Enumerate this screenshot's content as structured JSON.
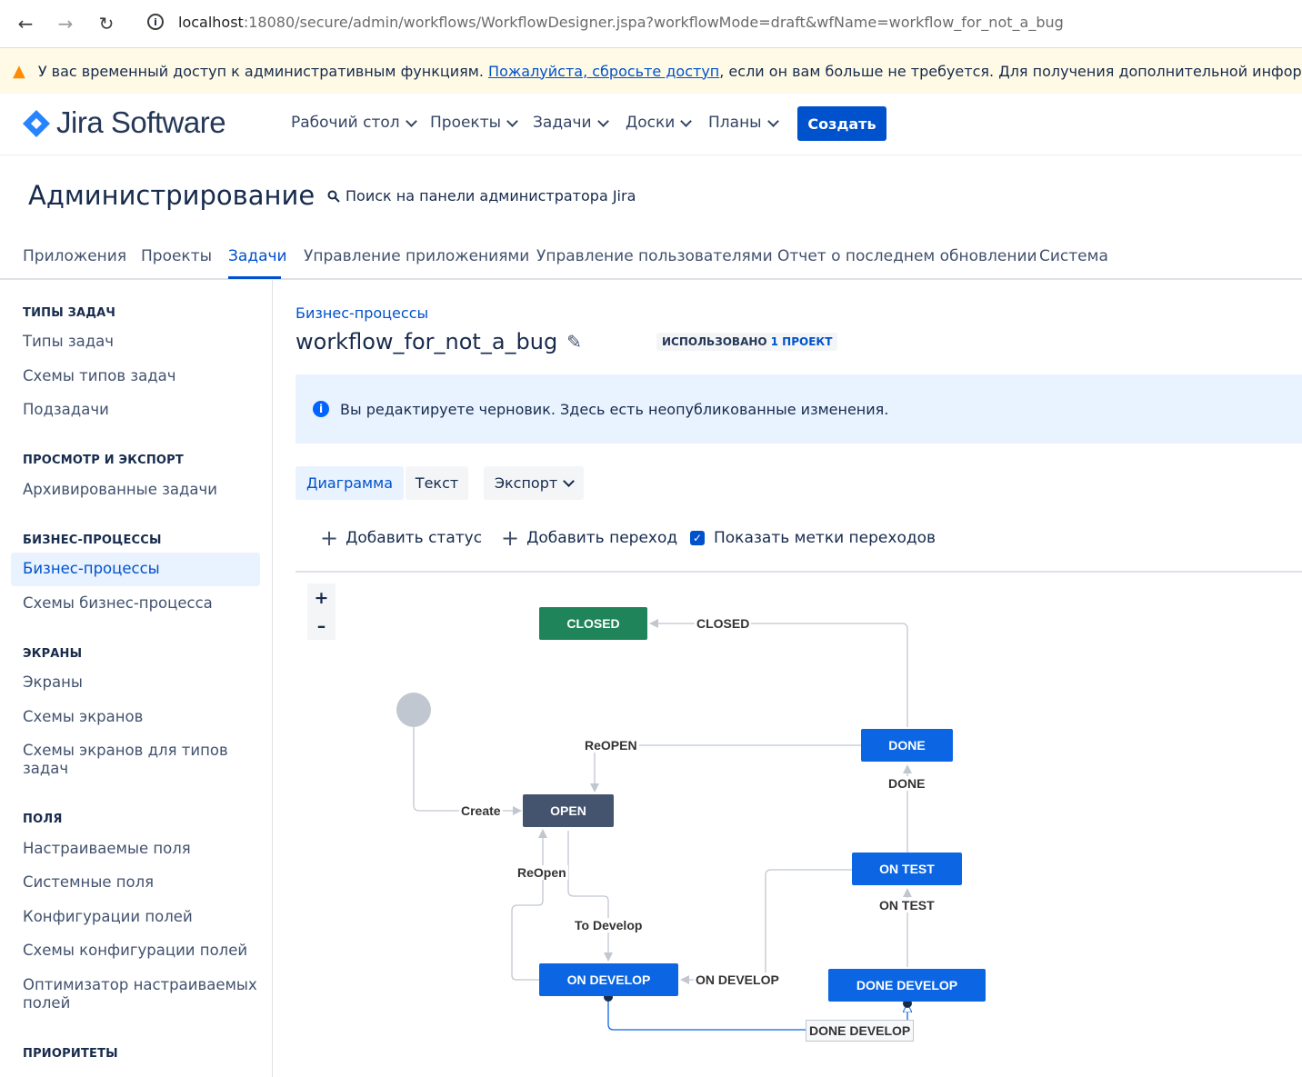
{
  "browser": {
    "url_host": "localhost",
    "url_rest": ":18080/secure/admin/workflows/WorkflowDesigner.jspa?workflowMode=draft&wfName=workflow_for_not_a_bug"
  },
  "warning": {
    "text_before": "У вас временный доступ к административным функциям.",
    "link": "Пожалуйста, сбросьте доступ",
    "text_after": ", если он вам больше не требуется. Для получения дополнительной информации"
  },
  "header": {
    "logo": "Jira Software",
    "menu": [
      "Рабочий стол",
      "Проекты",
      "Задачи",
      "Доски",
      "Планы"
    ],
    "create": "Создать"
  },
  "admin": {
    "title": "Администрирование",
    "search": "Поиск на панели администратора Jira",
    "tabs": [
      "Приложения",
      "Проекты",
      "Задачи",
      "Управление приложениями",
      "Управление пользователями",
      "Отчет о последнем обновлении",
      "Система"
    ]
  },
  "sidebar": {
    "sections": [
      {
        "heading": "ТИПЫ ЗАДАЧ",
        "items": [
          "Типы задач",
          "Схемы типов задач",
          "Подзадачи"
        ]
      },
      {
        "heading": "ПРОСМОТР И ЭКСПОРТ",
        "items": [
          "Архивированные задачи"
        ]
      },
      {
        "heading": "БИЗНЕС-ПРОЦЕССЫ",
        "items": [
          "Бизнес-процессы",
          "Схемы бизнес-процесса"
        ]
      },
      {
        "heading": "ЭКРАНЫ",
        "items": [
          "Экраны",
          "Схемы экранов",
          "Схемы экранов для типов задач"
        ]
      },
      {
        "heading": "ПОЛЯ",
        "items": [
          "Настраиваемые поля",
          "Системные поля",
          "Конфигурации полей",
          "Схемы конфигурации полей",
          "Оптимизатор настраиваемых полей"
        ]
      },
      {
        "heading": "ПРИОРИТЕТЫ",
        "items": []
      }
    ]
  },
  "main": {
    "breadcrumb": "Бизнес-процессы",
    "title": "workflow_for_not_a_bug",
    "used_label": "ИСПОЛЬЗОВАНО",
    "used_value": "1 ПРОЕКТ",
    "info": "Вы редактируете черновик. Здесь есть неопубликованные изменения.",
    "views": [
      "Диаграмма",
      "Текст"
    ],
    "export": "Экспорт",
    "add_status": "Добавить статус",
    "add_transition": "Добавить переход",
    "show_labels": "Показать метки переходов",
    "zoom_in": "+",
    "zoom_out": "–"
  },
  "diagram": {
    "statuses": {
      "closed": "CLOSED",
      "done": "DONE",
      "open": "OPEN",
      "on_test": "ON TEST",
      "on_develop": "ON DEVELOP",
      "done_develop": "DONE DEVELOP"
    },
    "transitions": {
      "closed": "CLOSED",
      "reopen_upper": "ReOPEN",
      "done": "DONE",
      "create": "Create",
      "reopen_lower": "ReOpen",
      "to_develop": "To Develop",
      "on_test": "ON TEST",
      "on_develop": "ON DEVELOP",
      "done_develop": "DONE DEVELOP"
    },
    "colors": {
      "closed": "#1f845a",
      "open": "#44546f",
      "blue": "#0c66e4"
    }
  }
}
